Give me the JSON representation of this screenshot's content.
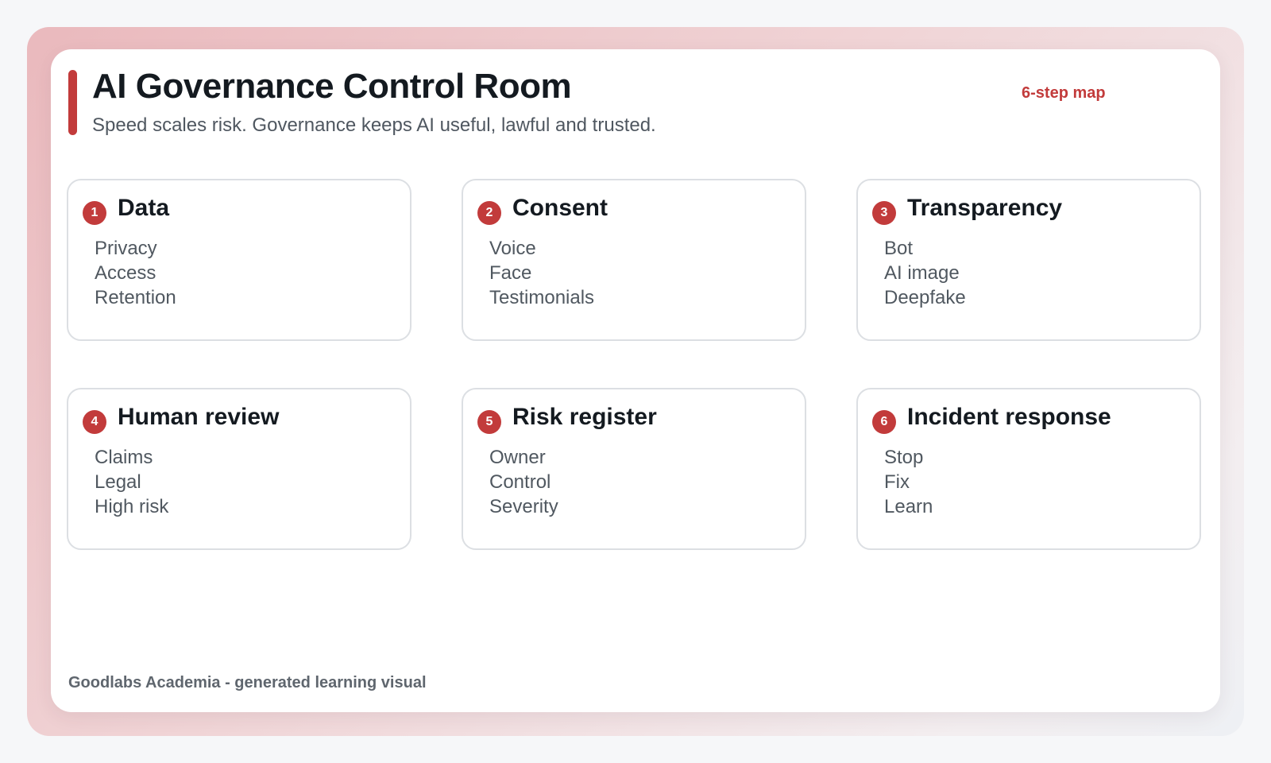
{
  "header": {
    "title": "AI Governance Control Room",
    "subtitle": "Speed scales risk. Governance keeps AI useful, lawful and trusted.",
    "tag": "6-step map"
  },
  "steps": [
    {
      "number": "1",
      "title": "Data",
      "items": [
        "Privacy",
        "Access",
        "Retention"
      ]
    },
    {
      "number": "2",
      "title": "Consent",
      "items": [
        "Voice",
        "Face",
        "Testimonials"
      ]
    },
    {
      "number": "3",
      "title": "Transparency",
      "items": [
        "Bot",
        "AI image",
        "Deepfake"
      ]
    },
    {
      "number": "4",
      "title": "Human review",
      "items": [
        "Claims",
        "Legal",
        "High risk"
      ]
    },
    {
      "number": "5",
      "title": "Risk register",
      "items": [
        "Owner",
        "Control",
        "Severity"
      ]
    },
    {
      "number": "6",
      "title": "Incident response",
      "items": [
        "Stop",
        "Fix",
        "Learn"
      ]
    }
  ],
  "footer": {
    "text": "Goodlabs Academia - generated learning visual"
  },
  "colors": {
    "accent": "#c23b3b",
    "title": "#141a20",
    "body_text": "#505860",
    "border": "#dcdfe3"
  }
}
